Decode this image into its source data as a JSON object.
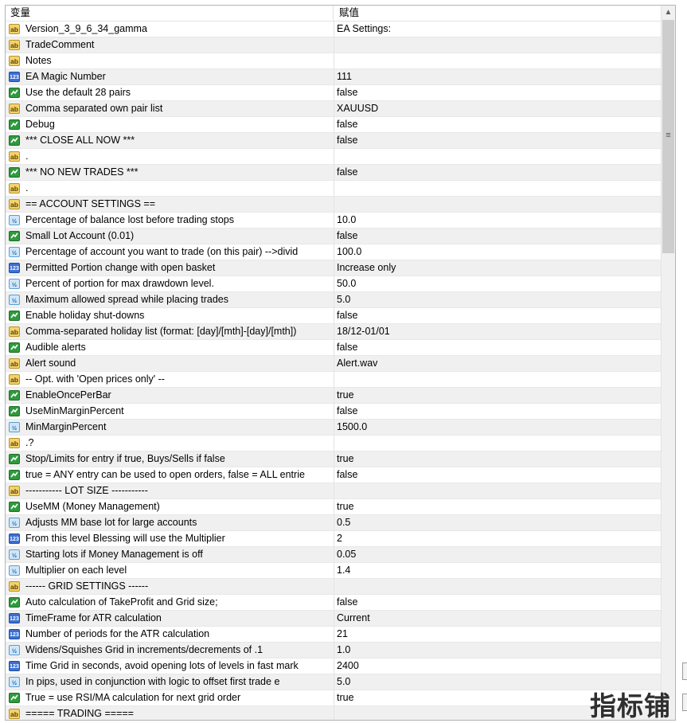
{
  "header": {
    "col_variable": "变量",
    "col_value": "赋值"
  },
  "rows": [
    {
      "icon": "ab",
      "name": "Version_3_9_6_34_gamma",
      "value": "EA Settings:"
    },
    {
      "icon": "ab",
      "name": "TradeComment",
      "value": ""
    },
    {
      "icon": "ab",
      "name": "Notes",
      "value": ""
    },
    {
      "icon": "123",
      "name": "EA Magic Number",
      "value": "111"
    },
    {
      "icon": "bool",
      "name": "Use the default 28 pairs",
      "value": "false"
    },
    {
      "icon": "ab",
      "name": "Comma separated own pair list",
      "value": "XAUUSD"
    },
    {
      "icon": "bool",
      "name": "Debug",
      "value": "false"
    },
    {
      "icon": "bool",
      "name": "*** CLOSE ALL NOW ***",
      "value": "false"
    },
    {
      "icon": "ab",
      "name": ".",
      "value": ""
    },
    {
      "icon": "bool",
      "name": "*** NO NEW TRADES ***",
      "value": "false"
    },
    {
      "icon": "ab",
      "name": ".",
      "value": ""
    },
    {
      "icon": "ab",
      "name": "==   ACCOUNT SETTINGS   ==",
      "value": ""
    },
    {
      "icon": "dbl",
      "name": "Percentage of balance lost before trading stops",
      "value": "10.0"
    },
    {
      "icon": "bool",
      "name": "Small Lot Account (0.01)",
      "value": "false"
    },
    {
      "icon": "dbl",
      "name": "Percentage of account you want to trade (on this pair) -->divid",
      "value": "100.0"
    },
    {
      "icon": "123",
      "name": "Permitted Portion change with open basket",
      "value": "Increase only"
    },
    {
      "icon": "dbl",
      "name": "Percent of portion for max drawdown level.",
      "value": "50.0"
    },
    {
      "icon": "dbl",
      "name": "Maximum allowed spread while placing trades",
      "value": "5.0"
    },
    {
      "icon": "bool",
      "name": "Enable holiday shut-downs",
      "value": "false"
    },
    {
      "icon": "ab",
      "name": "Comma-separated holiday list (format: [day]/[mth]-[day]/[mth])",
      "value": "18/12-01/01"
    },
    {
      "icon": "bool",
      "name": "Audible alerts",
      "value": "false"
    },
    {
      "icon": "ab",
      "name": "Alert sound",
      "value": "Alert.wav"
    },
    {
      "icon": "ab",
      "name": "-- Opt. with 'Open prices only' --",
      "value": ""
    },
    {
      "icon": "bool",
      "name": "EnableOncePerBar",
      "value": "true"
    },
    {
      "icon": "bool",
      "name": "UseMinMarginPercent",
      "value": "false"
    },
    {
      "icon": "dbl",
      "name": "MinMarginPercent",
      "value": "1500.0"
    },
    {
      "icon": "ab",
      "name": ".?",
      "value": ""
    },
    {
      "icon": "bool",
      "name": "Stop/Limits for entry if true, Buys/Sells if false",
      "value": "true"
    },
    {
      "icon": "bool",
      "name": "true = ANY entry can be used to open orders, false = ALL entrie",
      "value": "false"
    },
    {
      "icon": "ab",
      "name": "-----------   LOT SIZE   -----------",
      "value": ""
    },
    {
      "icon": "bool",
      "name": "UseMM   (Money Management)",
      "value": "true"
    },
    {
      "icon": "dbl",
      "name": "Adjusts MM base lot for large accounts",
      "value": "0.5"
    },
    {
      "icon": "123",
      "name": "From this level Blessing will use the Multiplier",
      "value": "2"
    },
    {
      "icon": "dbl",
      "name": "Starting lots if Money Management is off",
      "value": "0.05"
    },
    {
      "icon": "dbl",
      "name": "Multiplier on each level",
      "value": "1.4"
    },
    {
      "icon": "ab",
      "name": "------     GRID SETTINGS     ------",
      "value": ""
    },
    {
      "icon": "bool",
      "name": "Auto calculation of TakeProfit and Grid size;",
      "value": "false"
    },
    {
      "icon": "123",
      "name": "TimeFrame for ATR calculation",
      "value": "Current"
    },
    {
      "icon": "123",
      "name": "Number of periods for the ATR calculation",
      "value": "21"
    },
    {
      "icon": "dbl",
      "name": "Widens/Squishes Grid in increments/decrements of .1",
      "value": "1.0"
    },
    {
      "icon": "123",
      "name": "Time Grid in seconds, avoid opening lots of levels in fast mark",
      "value": "2400"
    },
    {
      "icon": "dbl",
      "name": "In pips, used in conjunction with logic to offset first trade e",
      "value": "5.0"
    },
    {
      "icon": "bool",
      "name": "True = use RSI/MA calculation for next grid order",
      "value": "true"
    },
    {
      "icon": "ab",
      "name": "=====    TRADING    =====",
      "value": ""
    }
  ],
  "icons": {
    "ab": "string-type-icon",
    "123": "integer-type-icon",
    "bool": "boolean-type-icon",
    "dbl": "double-type-icon"
  },
  "watermark": "指标铺",
  "colors": {
    "alt_row": "#f0f0f0",
    "grid": "#e8e8e8",
    "scroll_thumb": "#cdcdcd"
  }
}
